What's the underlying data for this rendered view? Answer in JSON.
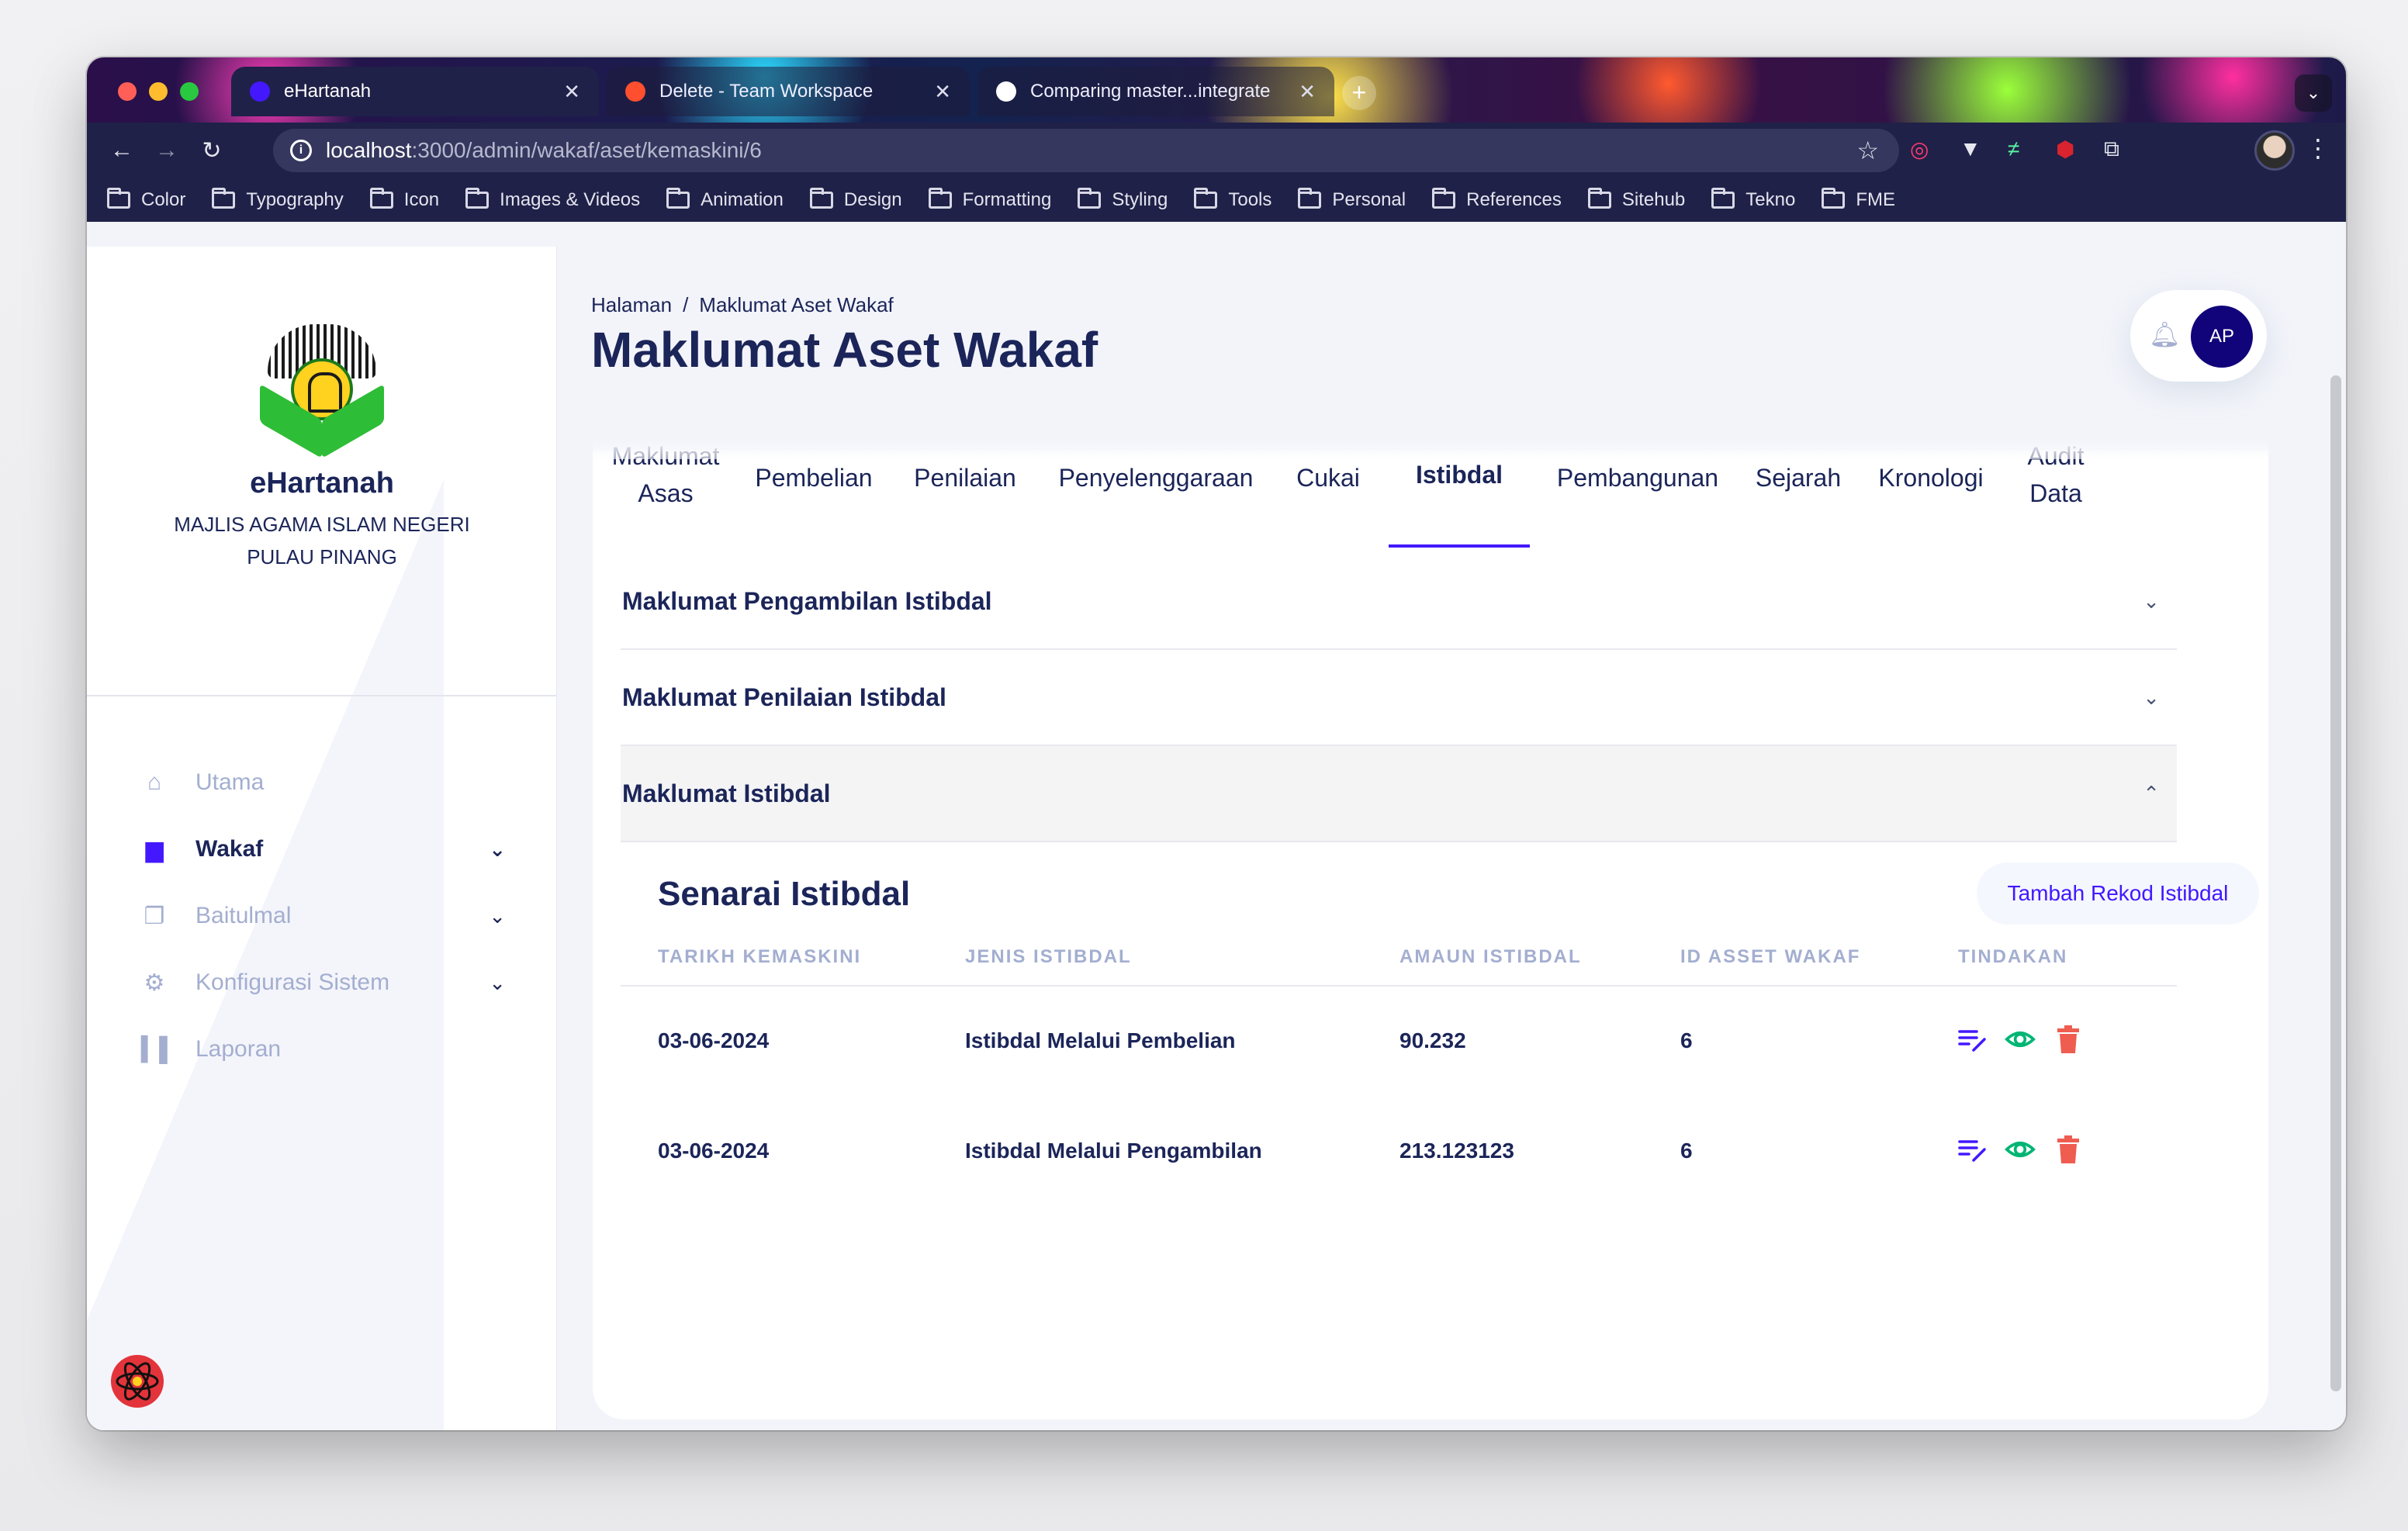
{
  "browser": {
    "tabs": [
      {
        "title": "eHartanah",
        "active": true
      },
      {
        "title": "Delete - Team Workspace",
        "active": false
      },
      {
        "title": "Comparing master...integrate",
        "active": false
      }
    ],
    "url_host": "localhost",
    "url_path": ":3000/admin/wakaf/aset/kemaskini/6",
    "bookmarks": [
      "Color",
      "Typography",
      "Icon",
      "Images & Videos",
      "Animation",
      "Design",
      "Formatting",
      "Styling",
      "Tools",
      "Personal",
      "References",
      "Sitehub",
      "Tekno",
      "FME"
    ]
  },
  "sidebar": {
    "app_name": "eHartanah",
    "org_line1": "MAJLIS AGAMA ISLAM NEGERI",
    "org_line2": "PULAU PINANG",
    "menu": [
      {
        "label": "Utama",
        "icon": "home-icon",
        "active": false,
        "expandable": false
      },
      {
        "label": "Wakaf",
        "icon": "folder-icon",
        "active": true,
        "expandable": true
      },
      {
        "label": "Baitulmal",
        "icon": "file-icon",
        "active": false,
        "expandable": true
      },
      {
        "label": "Konfigurasi Sistem",
        "icon": "gear-icon",
        "active": false,
        "expandable": true
      },
      {
        "label": "Laporan",
        "icon": "bar-chart-icon",
        "active": false,
        "expandable": false
      }
    ]
  },
  "header": {
    "breadcrumb_root": "Halaman",
    "breadcrumb_sep": "/",
    "breadcrumb_current": "Maklumat Aset Wakaf",
    "title": "Maklumat Aset Wakaf",
    "avatar_initials": "AP"
  },
  "tabs": {
    "items": [
      {
        "line1": "Maklumat",
        "line2": "Asas"
      },
      {
        "line1": "Pembelian",
        "line2": ""
      },
      {
        "line1": "Penilaian",
        "line2": ""
      },
      {
        "line1": "Penyelenggaraan",
        "line2": ""
      },
      {
        "line1": "Cukai",
        "line2": ""
      },
      {
        "line1": "Istibdal",
        "line2": ""
      },
      {
        "line1": "Pembangunan",
        "line2": ""
      },
      {
        "line1": "Sejarah",
        "line2": ""
      },
      {
        "line1": "Kronologi",
        "line2": ""
      },
      {
        "line1": "Audit",
        "line2": "Data"
      }
    ],
    "active": "Istibdal"
  },
  "accordions": [
    {
      "title": "Maklumat Pengambilan Istibdal",
      "open": false
    },
    {
      "title": "Maklumat Penilaian Istibdal",
      "open": false
    },
    {
      "title": "Maklumat Istibdal",
      "open": true
    }
  ],
  "list": {
    "title": "Senarai Istibdal",
    "add_label": "Tambah Rekod Istibdal",
    "columns": [
      "TARIKH KEMASKINI",
      "JENIS ISTIBDAL",
      "AMAUN ISTIBDAL",
      "ID ASSET WAKAF",
      "TINDAKAN"
    ],
    "rows": [
      {
        "date": "03-06-2024",
        "type": "Istibdal Melalui Pembelian",
        "amount": "90.232",
        "asset_id": "6"
      },
      {
        "date": "03-06-2024",
        "type": "Istibdal Melalui Pengambilan",
        "amount": "213.123123",
        "asset_id": "6"
      }
    ]
  },
  "colors": {
    "primary": "#4318ff",
    "navy": "#1b2559",
    "muted": "#a3aed0",
    "edit": "#4318ff",
    "view": "#01b574",
    "delete": "#ee5d50"
  }
}
